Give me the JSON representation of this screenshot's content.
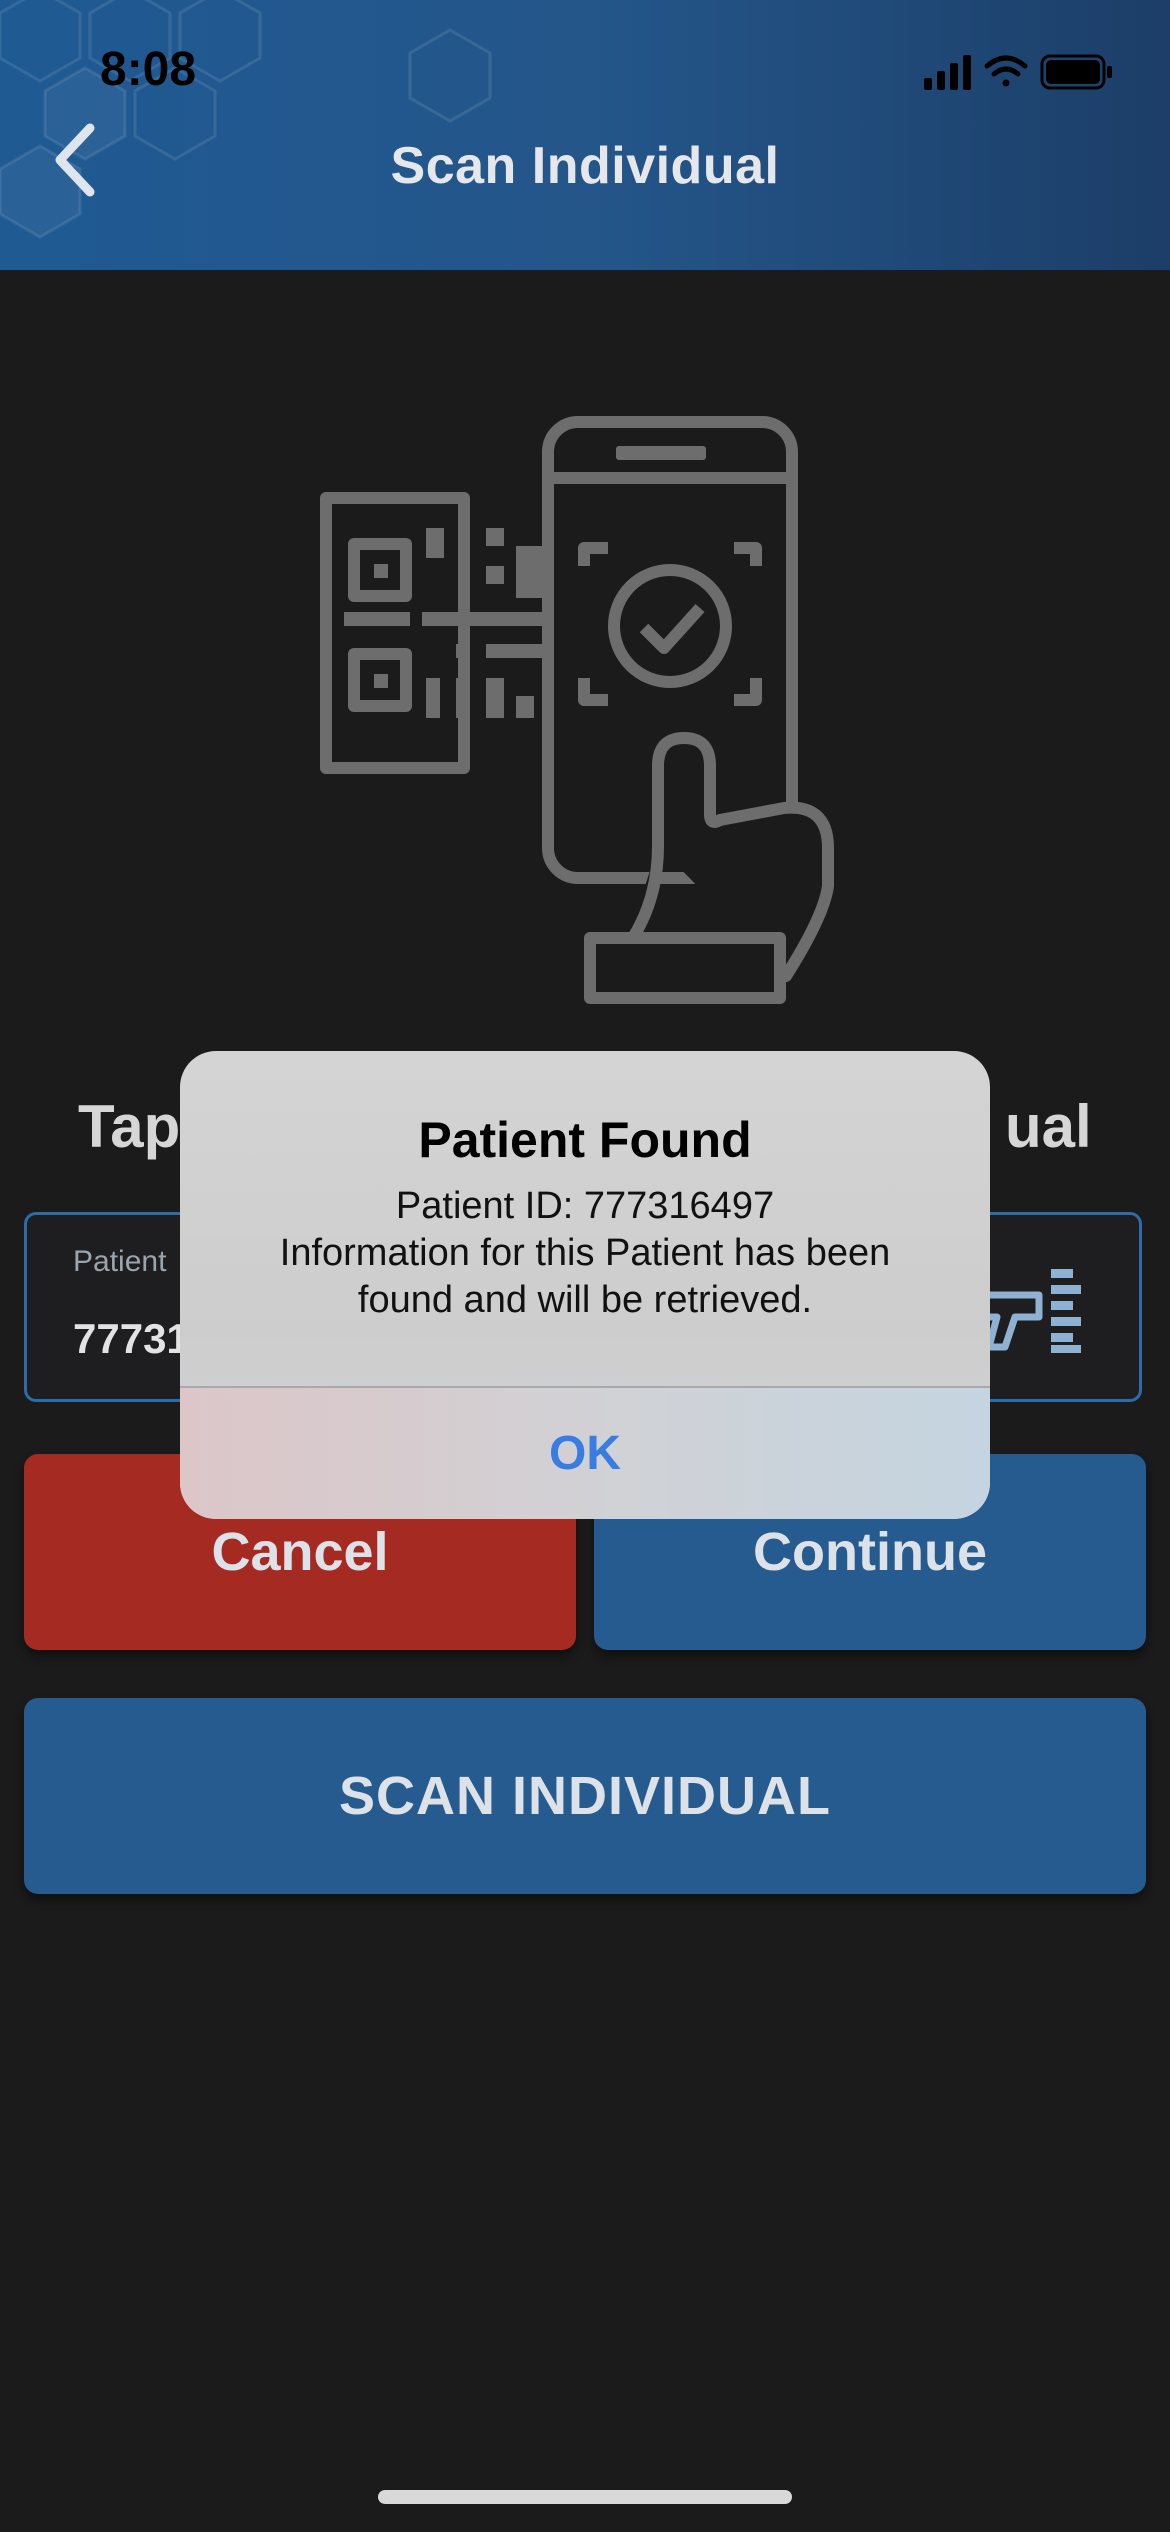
{
  "status_bar": {
    "time": "8:08"
  },
  "header": {
    "title": "Scan Individual",
    "back_icon": "chevron-left-icon"
  },
  "hero": {
    "icon": "phone-qr-scan-icon"
  },
  "prompt": {
    "left_text": "Tap",
    "right_text": "ual"
  },
  "patient_field": {
    "label": "Patient",
    "value": "77731",
    "icon": "barcode-scanner-icon"
  },
  "buttons": {
    "cancel": "Cancel",
    "continue": "Continue",
    "scan": "SCAN INDIVIDUAL"
  },
  "dialog": {
    "title": "Patient Found",
    "line1": "Patient ID: 777316497",
    "line2": "Information for this Patient has been",
    "line3": "found and will be retrieved.",
    "ok": "OK"
  },
  "colors": {
    "accent": "#265b8f",
    "cancel": "#a52b22",
    "link": "#3a7de0",
    "background": "#1b1b1c"
  }
}
